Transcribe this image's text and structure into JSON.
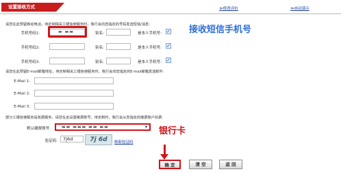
{
  "header": {
    "tab_title": "设置接收方式",
    "links": [
      "≫修改评价",
      "≫自动演示"
    ]
  },
  "mobile": {
    "instruction": "请您在此预留移动电话，待定制相关工银信使服务时，我行会向您指定的号码发送短信/消息:",
    "rows": [
      {
        "label": "手机号码1:",
        "value": "▬ ▬▬",
        "alias_label": "别名:",
        "self_label": "是本人手机号:",
        "checked": true
      },
      {
        "label": "手机号码2:",
        "value": "",
        "alias_label": "别名:",
        "self_label": "是本人手机号:",
        "checked": true
      },
      {
        "label": "手机号码3:",
        "value": "",
        "alias_label": "别名:",
        "self_label": "是本人手机号:",
        "checked": true
      }
    ]
  },
  "email": {
    "instruction": "请您在此预留E-mail邮箱地址，待定制相关工银信使服务时，我行会向您指定的E-mail邮箱发送邮件:",
    "rows": [
      {
        "label": "E-Mail 1:"
      },
      {
        "label": "E-Mail 2:"
      },
      {
        "label": "E-Mail 3:"
      }
    ]
  },
  "fee": {
    "instruction": "部分工银信使服务是收费服务，请您在此设置缴费账号，待定制时，我行会从您指定的缴费账户扣费:",
    "default_label": "默认缴费账号:",
    "default_value": "▬▬ ▬▬▬ ▬▬ ▬▬",
    "captcha_label": "验证码:",
    "captcha_input": "7j6d",
    "captcha_image": "7j 6d",
    "refresh_link": "刷新验证码"
  },
  "annotations": {
    "sms_phone": "接收短信手机号",
    "bank_card": "银行卡"
  },
  "buttons": {
    "confirm": "确 定",
    "clear": "清 空",
    "back": "返 回"
  },
  "colors": {
    "accent": "#c81d1f",
    "annotation_blue": "#2f6fd6",
    "annotation_red": "#d0141a",
    "link": "#1a3f9e"
  }
}
